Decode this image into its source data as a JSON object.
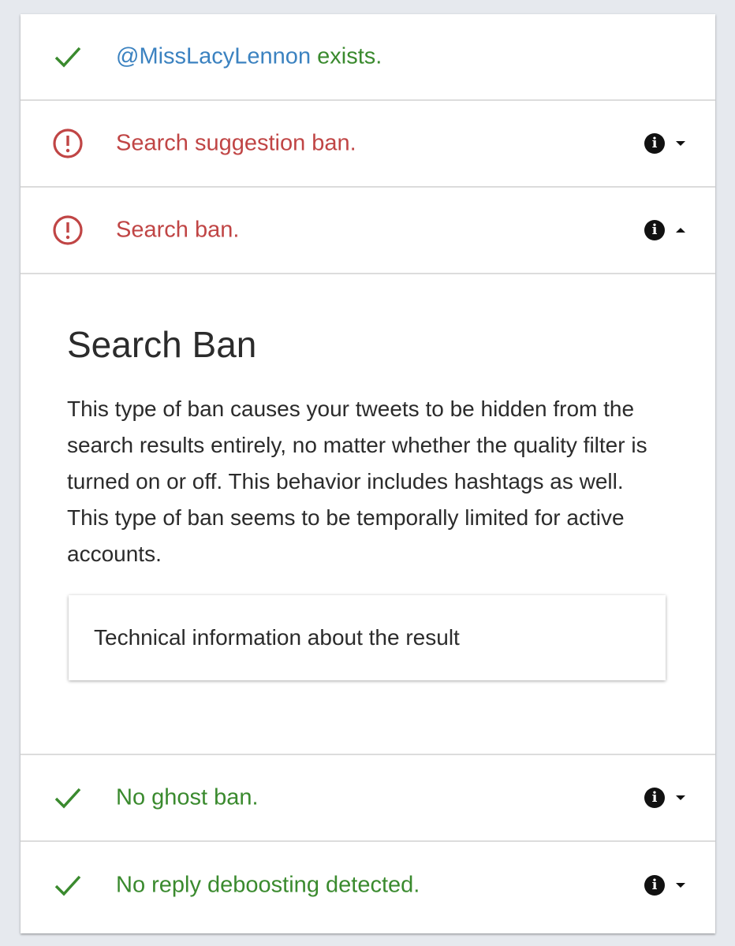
{
  "rows": [
    {
      "handle": "@MissLacyLennon",
      "text": " exists.",
      "icon": "check-icon",
      "status": "ok"
    },
    {
      "text": "Search suggestion ban.",
      "icon": "alert-circle-icon",
      "status": "bad",
      "expanded": false
    },
    {
      "text": "Search ban.",
      "icon": "alert-circle-icon",
      "status": "bad",
      "expanded": true
    },
    {
      "text": "No ghost ban.",
      "icon": "check-icon",
      "status": "ok",
      "expanded": false
    },
    {
      "text": "No reply deboosting detected.",
      "icon": "check-icon",
      "status": "ok",
      "expanded": false
    }
  ],
  "search_ban_panel": {
    "title": "Search Ban",
    "body": "This type of ban causes your tweets to be hidden from the search results entirely, no matter whether the quality filter is turned on or off. This behavior includes hashtags as well. This type of ban seems to be temporally limited for active accounts.",
    "tech_info_label": "Technical information about the result"
  },
  "colors": {
    "ok": "#3a8a2e",
    "bad": "#c04545",
    "handle": "#3b82c0",
    "background": "#e6e9ee"
  },
  "info_glyph": "i"
}
